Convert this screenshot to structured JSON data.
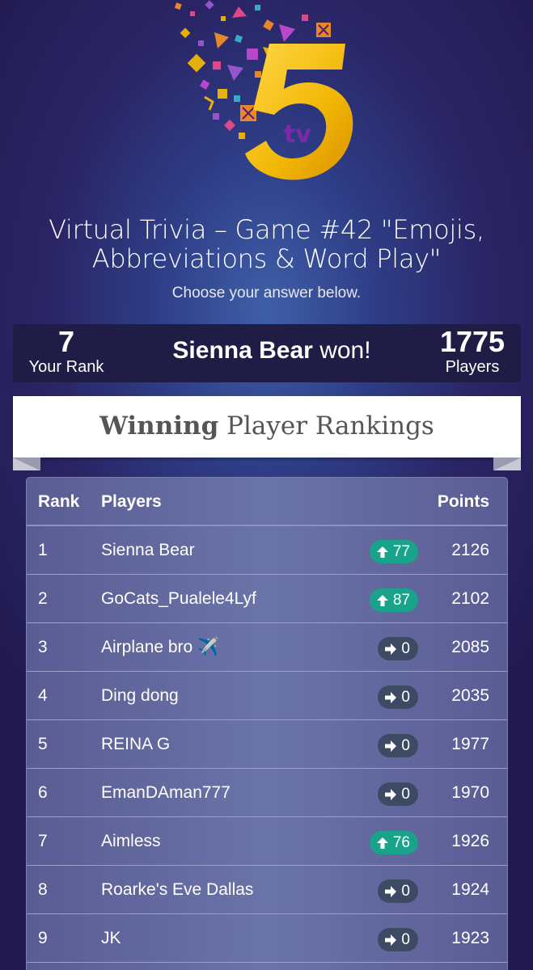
{
  "header": {
    "logo_text": "tv",
    "title_line1": "Virtual Trivia – Game #42 \"Emojis,",
    "title_line2": "Abbreviations & Word Play\"",
    "subtitle": "Choose your answer below."
  },
  "rank_bar": {
    "your_rank": "7",
    "your_rank_label": "Your Rank",
    "winner_name": "Sienna Bear",
    "winner_suffix": "won!",
    "players_count": "1775",
    "players_label": "Players"
  },
  "rankings_banner": {
    "bold": "Winning",
    "rest": "Player Rankings"
  },
  "table": {
    "headers": {
      "rank": "Rank",
      "players": "Players",
      "points": "Points"
    },
    "rows": [
      {
        "rank": "1",
        "name": "Sienna Bear",
        "change": "77",
        "trend": "up",
        "points": "2126"
      },
      {
        "rank": "2",
        "name": "GoCats_Pualele4Lyf",
        "change": "87",
        "trend": "up",
        "points": "2102"
      },
      {
        "rank": "3",
        "name": "Airplane bro ✈️",
        "change": "0",
        "trend": "same",
        "points": "2085"
      },
      {
        "rank": "4",
        "name": "Ding dong",
        "change": "0",
        "trend": "same",
        "points": "2035"
      },
      {
        "rank": "5",
        "name": "REINA G",
        "change": "0",
        "trend": "same",
        "points": "1977"
      },
      {
        "rank": "6",
        "name": "EmanDAman777",
        "change": "0",
        "trend": "same",
        "points": "1970"
      },
      {
        "rank": "7",
        "name": "Aimless",
        "change": "76",
        "trend": "up",
        "points": "1926"
      },
      {
        "rank": "8",
        "name": "Roarke's Eve Dallas",
        "change": "0",
        "trend": "same",
        "points": "1924"
      },
      {
        "rank": "9",
        "name": "JK",
        "change": "0",
        "trend": "same",
        "points": "1923"
      }
    ]
  },
  "colors": {
    "up_badge": "#19a38a",
    "same_badge": "#3d4a63",
    "logo_gold": "#f2b705",
    "logo_purple": "#7a2ca8"
  }
}
